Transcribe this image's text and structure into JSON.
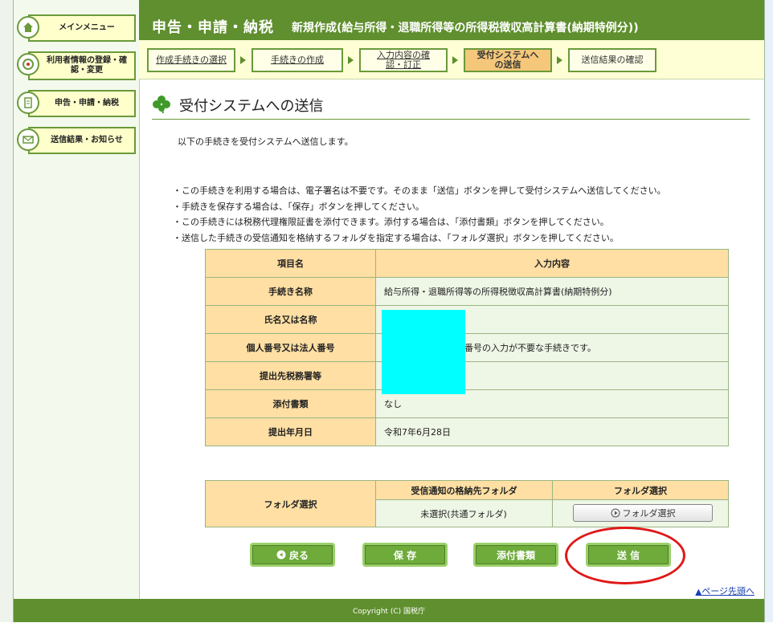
{
  "sidebar": {
    "items": [
      {
        "label": "メインメニュー",
        "icon": "home-icon"
      },
      {
        "label": "利用者情報の登録・確認・変更",
        "icon": "target-icon"
      },
      {
        "label": "申告・申請・納税",
        "icon": "document-icon"
      },
      {
        "label": "送信結果・お知らせ",
        "icon": "mail-icon"
      }
    ]
  },
  "header": {
    "title": "申告・申請・納税",
    "subtitle": "新規作成(給与所得・退職所得等の所得税徴収高計算書(納期特例分))"
  },
  "steps": [
    {
      "label": "作成手続きの選択"
    },
    {
      "label": "手続きの作成"
    },
    {
      "label": "入力内容の確認・訂正"
    },
    {
      "label": "受付システムへの送信"
    },
    {
      "label": "送信結果の確認"
    }
  ],
  "page": {
    "heading": "受付システムへの送信",
    "intro": "以下の手続きを受付システムへ送信します。",
    "bullets": [
      "この手続きを利用する場合は、電子署名は不要です。そのまま「送信」ボタンを押して受付システムへ送信してください。",
      "手続きを保存する場合は、「保存」ボタンを押してください。",
      "この手続きには税務代理権限証書を添付できます。添付する場合は、「添付書類」ボタンを押してください。",
      "送信した手続きの受信通知を格納するフォルダを指定する場合は、「フォルダ選択」ボタンを押してください。"
    ]
  },
  "details_table": {
    "header_item": "項目名",
    "header_value": "入力内容",
    "rows": [
      {
        "label": "手続き名称",
        "value": "給与所得・退職所得等の所得税徴収高計算書(納期特例分)"
      },
      {
        "label": "氏名又は名称",
        "value": ""
      },
      {
        "label": "個人番号又は法人番号",
        "value": "番号の入力が不要な手続きです。"
      },
      {
        "label": "提出先税務署等",
        "value": ""
      },
      {
        "label": "添付書類",
        "value": "なし"
      },
      {
        "label": "提出年月日",
        "value": "令和7年6月28日"
      }
    ]
  },
  "folder_table": {
    "row_label": "フォルダ選択",
    "col1_header": "受信通知の格納先フォルダ",
    "col2_header": "フォルダ選択",
    "current_folder": "未選択(共通フォルダ)",
    "select_button": "フォルダ選択"
  },
  "buttons": {
    "back": "戻る",
    "save": "保 存",
    "attach": "添付書類",
    "send": "送 信"
  },
  "page_top_link": "ページ先頭へ",
  "footer": "Copyright (C) 国税庁",
  "colors": {
    "brand_green": "#5f8f2e",
    "current_step": "#f4c77a",
    "highlight_circle": "#e01818"
  }
}
